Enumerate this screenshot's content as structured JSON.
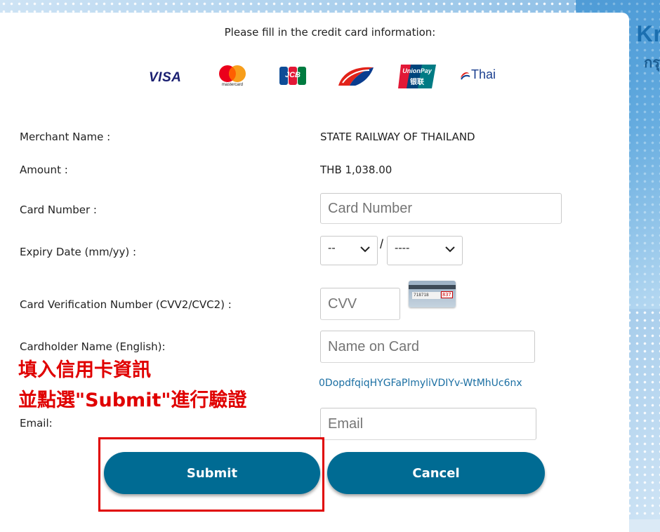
{
  "brand": {
    "name_partial": "Kr",
    "sub_partial": "กรุ"
  },
  "header": {
    "title": "Please fill in the credit card information:"
  },
  "logos": {
    "visa": "VISA",
    "mastercard": "mastercard",
    "jcb": "JCB",
    "unionpay": "UnionPay",
    "unionpay_cn": "银联",
    "thai": "Thai"
  },
  "form": {
    "merchant": {
      "label": "Merchant Name :",
      "value": "STATE RAILWAY OF THAILAND"
    },
    "amount": {
      "label": "Amount :",
      "value": "THB 1,038.00"
    },
    "card_number": {
      "label": "Card Number :",
      "placeholder": "Card Number"
    },
    "expiry": {
      "label": "Expiry Date (mm/yy) :",
      "month": "--",
      "year": "----",
      "separator": "/"
    },
    "cvv": {
      "label": "Card Verification Number (CVV2/CVC2) :",
      "placeholder": "CVV",
      "card_digits": "718718",
      "card_cvv": "837"
    },
    "name": {
      "label": "Cardholder Name (English):",
      "placeholder": "Name on Card"
    },
    "token": "0DopdfqiqHYGFaPlmyliVDIYv-WtMhUc6nx",
    "email": {
      "label": "Email:",
      "placeholder": "Email"
    }
  },
  "annotation": {
    "line1": "填入信用卡資訊",
    "line2": "並點選\"Submit\"進行驗證"
  },
  "buttons": {
    "submit": "Submit",
    "cancel": "Cancel"
  },
  "colors": {
    "button": "#006b93",
    "annotation": "#e00000",
    "token": "#1b6fa3"
  }
}
